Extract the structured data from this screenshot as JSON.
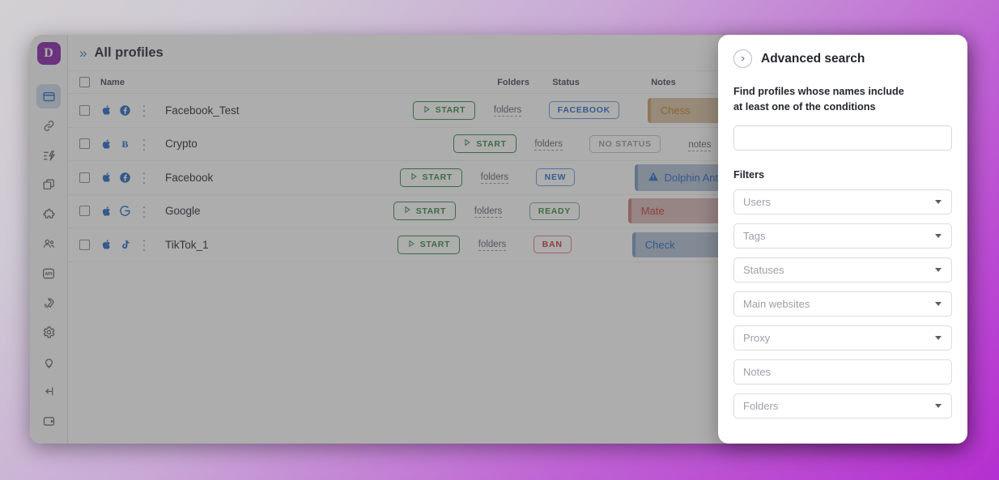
{
  "app": {
    "brand_initial": "D",
    "sidebar_items": [
      {
        "name": "browser-profiles",
        "icon": "browser-window-icon",
        "active": true
      },
      {
        "name": "proxies",
        "icon": "link-icon",
        "active": false
      },
      {
        "name": "automation",
        "icon": "automation-bolt-icon",
        "active": false
      },
      {
        "name": "extensions-copy",
        "icon": "copy-windows-icon",
        "active": false
      },
      {
        "name": "plugins",
        "icon": "puzzle-icon",
        "active": false
      },
      {
        "name": "team",
        "icon": "users-icon",
        "active": false
      },
      {
        "name": "api",
        "icon": "api-icon",
        "active": false
      },
      {
        "name": "get-started",
        "icon": "rocket-icon",
        "active": false
      },
      {
        "name": "settings",
        "icon": "gear-icon",
        "active": false
      },
      {
        "name": "tips",
        "icon": "lightbulb-icon",
        "active": false
      },
      {
        "name": "logout",
        "icon": "logout-arrow-icon",
        "active": false
      },
      {
        "name": "wallet",
        "icon": "wallet-icon",
        "active": false
      }
    ]
  },
  "topbar": {
    "collapse_icon": "»",
    "title": "All profiles",
    "actions": [
      {
        "name": "add-profile-button",
        "icon": "plus-icon"
      },
      {
        "name": "filter-button",
        "icon": "filter-icon"
      },
      {
        "name": "notifications-button",
        "icon": "bell-icon"
      }
    ]
  },
  "table": {
    "columns": [
      "Name",
      "Folders",
      "Status",
      "Notes"
    ],
    "start_label": "START",
    "folders_label": "folders",
    "rows": [
      {
        "name": "Facebook_Test",
        "os_icon": "apple-icon",
        "site_icon": "facebook-icon",
        "status": "FACEBOOK",
        "status_kind": "st-facebook",
        "note": "Chess",
        "note_kind": "chip",
        "note_bg": "#d9c3a5",
        "note_border": "#c9a469",
        "note_color": "#c08a2c",
        "note_icon": ""
      },
      {
        "name": "Crypto",
        "os_icon": "apple-icon",
        "site_icon": "bitcoin-icon",
        "status": "NO STATUS",
        "status_kind": "st-none",
        "note": "notes",
        "note_kind": "plain",
        "note_bg": "",
        "note_border": "",
        "note_color": "",
        "note_icon": ""
      },
      {
        "name": "Facebook",
        "os_icon": "apple-icon",
        "site_icon": "facebook-icon",
        "status": "NEW",
        "status_kind": "st-new",
        "note": "Dolphin Anty",
        "note_kind": "chip",
        "note_bg": "#b6c3d8",
        "note_border": "#7f9ecb",
        "note_color": "#2f6ec4",
        "note_icon": "warning-triangle-icon"
      },
      {
        "name": "Google",
        "os_icon": "apple-icon",
        "site_icon": "google-icon",
        "status": "READY",
        "status_kind": "st-ready",
        "note": "Mate",
        "note_kind": "chip",
        "note_bg": "#d9b8b8",
        "note_border": "#c98484",
        "note_color": "#c94444",
        "note_icon": ""
      },
      {
        "name": "TikTok_1",
        "os_icon": "apple-icon",
        "site_icon": "tiktok-icon",
        "status": "BAN",
        "status_kind": "st-ban",
        "note": "Check",
        "note_kind": "chip",
        "note_bg": "#b6c3d8",
        "note_border": "#7f9ecb",
        "note_color": "#2f6ec4",
        "note_icon": ""
      }
    ]
  },
  "advanced_search": {
    "back_icon": "chevron-right-icon",
    "title": "Advanced search",
    "prompt_line1": "Find profiles whose names include",
    "prompt_line2": "at least one of the conditions",
    "search_value": "",
    "search_placeholder": "",
    "filters_title": "Filters",
    "filters": [
      {
        "label": "Users",
        "has_caret": true
      },
      {
        "label": "Tags",
        "has_caret": true
      },
      {
        "label": "Statuses",
        "has_caret": true
      },
      {
        "label": "Main websites",
        "has_caret": true
      },
      {
        "label": "Proxy",
        "has_caret": true
      },
      {
        "label": "Notes",
        "has_caret": false
      },
      {
        "label": "Folders",
        "has_caret": true
      }
    ]
  },
  "colors": {
    "brand_purple": "#8e2bad",
    "accent_blue": "#2f6ec4",
    "green": "#3f8e4a",
    "red": "#cf3b3b"
  }
}
